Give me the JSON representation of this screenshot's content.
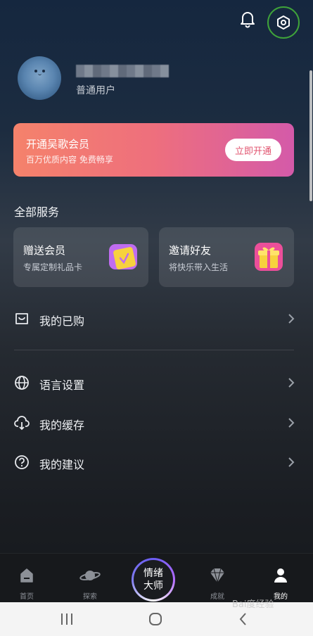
{
  "profile": {
    "tier": "普通用户"
  },
  "vip_banner": {
    "title": "开通吴歌会员",
    "subtitle": "百万优质内容 免费畅享",
    "button_label": "立即开通"
  },
  "services": {
    "section_title": "全部服务",
    "cards": [
      {
        "title": "赠送会员",
        "subtitle": "专属定制礼品卡",
        "icon": "gift-card-icon"
      },
      {
        "title": "邀请好友",
        "subtitle": "将快乐带入生活",
        "icon": "gift-box-icon"
      }
    ]
  },
  "menu": {
    "purchased": "我的已购",
    "language": "语言设置",
    "cache": "我的缓存",
    "feedback": "我的建议"
  },
  "tabbar": {
    "home": "首页",
    "explore": "探索",
    "center_line1": "情绪",
    "center_line2": "大师",
    "achievement": "成就",
    "mine": "我的"
  },
  "colors": {
    "accent_pink": "#e1546f",
    "highlight_ring": "#3fa33a"
  },
  "watermark": "Bai度经验"
}
